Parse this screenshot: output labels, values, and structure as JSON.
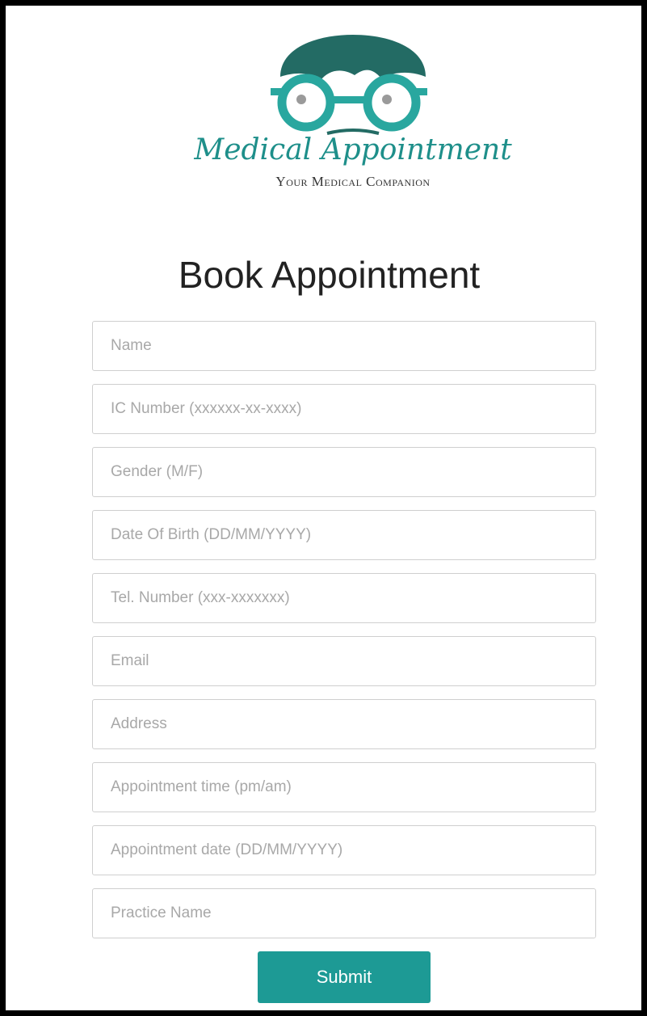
{
  "brand": {
    "name": "Medical Appointment",
    "tagline": "Your Medical Companion",
    "logo_icon": "doctor-face-glasses-icon",
    "color": "#1e8f8a"
  },
  "title": "Book Appointment",
  "form": {
    "fields": [
      {
        "placeholder": "Name",
        "value": ""
      },
      {
        "placeholder": "IC Number (xxxxxx-xx-xxxx)",
        "value": ""
      },
      {
        "placeholder": "Gender (M/F)",
        "value": ""
      },
      {
        "placeholder": "Date Of Birth (DD/MM/YYYY)",
        "value": ""
      },
      {
        "placeholder": "Tel. Number (xxx-xxxxxxx)",
        "value": ""
      },
      {
        "placeholder": "Email",
        "value": ""
      },
      {
        "placeholder": "Address",
        "value": ""
      },
      {
        "placeholder": "Appointment time (pm/am)",
        "value": ""
      },
      {
        "placeholder": "Appointment date (DD/MM/YYYY)",
        "value": ""
      },
      {
        "placeholder": "Practice Name",
        "value": ""
      }
    ],
    "submit_label": "Submit"
  },
  "colors": {
    "accent": "#1d9a95",
    "border": "#cfcfcf",
    "placeholder": "#a8a8a8"
  }
}
